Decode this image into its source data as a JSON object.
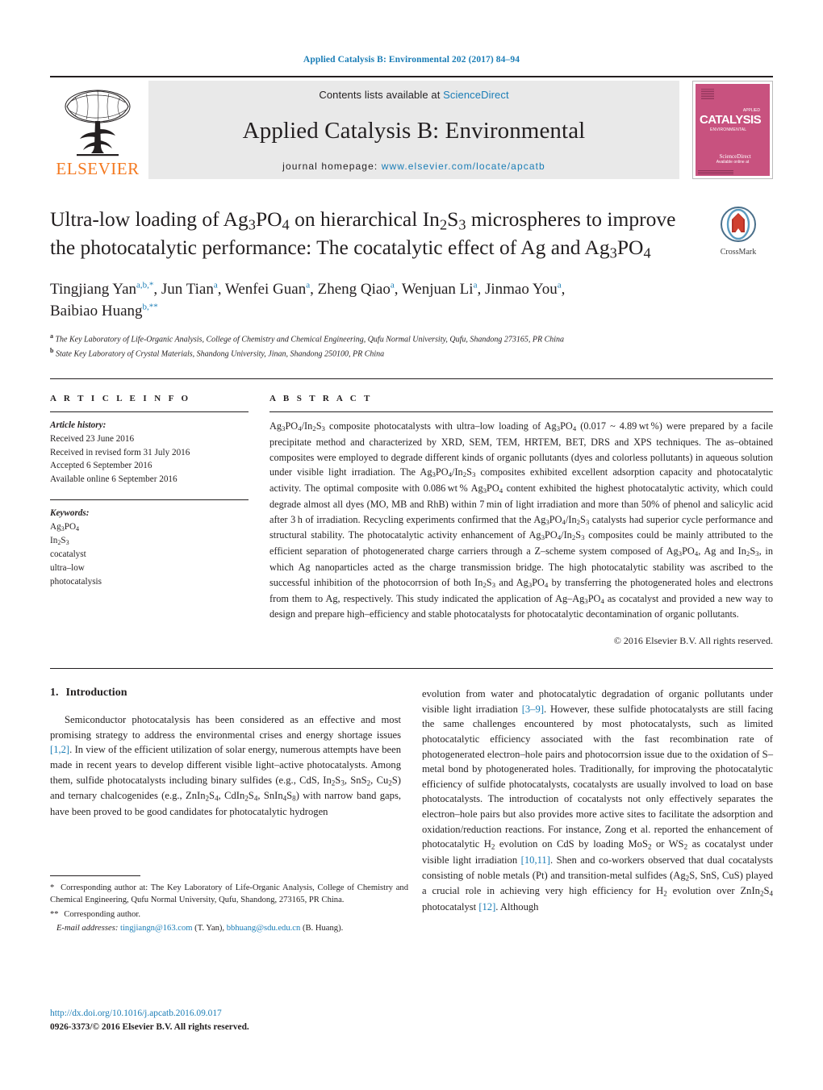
{
  "running_head": "Applied Catalysis B: Environmental 202 (2017) 84–94",
  "masthead": {
    "contents_prefix": "Contents lists available at ",
    "sciencedirect": "ScienceDirect",
    "journal_title": "Applied Catalysis B: Environmental",
    "homepage_prefix": "journal homepage: ",
    "homepage_url": "www.elsevier.com/locate/apcatb",
    "publisher": "ELSEVIER",
    "cover": {
      "title": "CATALYSIS",
      "superscript": "APPLIED",
      "subtitle": "ENVIRONMENTAL",
      "availability": "Available online at",
      "sciencedirect": "ScienceDirect"
    },
    "accent_blue": "#1a7db6",
    "elsevier_orange": "#f47920",
    "cover_pink": "#c8527f"
  },
  "article": {
    "title_line1": "Ultra-low loading of Ag3PO4 on hierarchical In2S3 microspheres to",
    "title_line2": "improve the photocatalytic performance: The cocatalytic effect of Ag",
    "title_line3": "and Ag3PO4",
    "crossmark_label": "CrossMark",
    "authors_line1": "Tingjiang Yan a,b,*, Jun Tian a, Wenfei Guan a, Zheng Qiao a, Wenjuan Li a, Jinmao You a,",
    "authors_line2": "Baibiao Huang b,**",
    "affiliation_a": "The Key Laboratory of Life-Organic Analysis, College of Chemistry and Chemical Engineering, Qufu Normal University, Qufu, Shandong 273165, PR China",
    "affiliation_b": "State Key Laboratory of Crystal Materials, Shandong University, Jinan, Shandong 250100, PR China"
  },
  "article_info": {
    "heading": "A R T I C L E    I N F O",
    "history_label": "Article history:",
    "received": "Received 23 June 2016",
    "revised": "Received in revised form 31 July 2016",
    "accepted": "Accepted 6 September 2016",
    "available": "Available online 6 September 2016",
    "keywords_label": "Keywords:",
    "keywords": [
      "Ag3PO4",
      "In2S3",
      "cocatalyst",
      "ultra–low",
      "photocatalysis"
    ]
  },
  "abstract": {
    "heading": "A B S T R A C T",
    "text": "Ag3PO4/In2S3 composite photocatalysts with ultra–low loading of Ag3PO4 (0.017 ~ 4.89 wt %) were prepared by a facile precipitate method and characterized by XRD, SEM, TEM, HRTEM, BET, DRS and XPS techniques. The as–obtained composites were employed to degrade different kinds of organic pollutants (dyes and colorless pollutants) in aqueous solution under visible light irradiation. The Ag3PO4/In2S3 composites exhibited excellent adsorption capacity and photocatalytic activity. The optimal composite with 0.086 wt % Ag3PO4 content exhibited the highest photocatalytic activity, which could degrade almost all dyes (MO, MB and RhB) within 7 min of light irradiation and more than 50% of phenol and salicylic acid after 3 h of irradiation. Recycling experiments confirmed that the Ag3PO4/In2S3 catalysts had superior cycle performance and structural stability. The photocatalytic activity enhancement of Ag3PO4/In2S3 composites could be mainly attributed to the efficient separation of photogenerated charge carriers through a Z–scheme system composed of Ag3PO4, Ag and In2S3, in which Ag nanoparticles acted as the charge transmission bridge. The high photocatalytic stability was ascribed to the successful inhibition of the photocorrsion of both In2S3 and Ag3PO4 by transferring the photogenerated holes and electrons from them to Ag, respectively. This study indicated the application of Ag–Ag3PO4 as cocatalyst and provided a new way to design and prepare high–efficiency and stable photocatalysts for photocatalytic decontamination of organic pollutants.",
    "copyright": "© 2016 Elsevier B.V. All rights reserved."
  },
  "introduction": {
    "number": "1.",
    "heading": "Introduction",
    "left_paragraph": "Semiconductor photocatalysis has been considered as an effective and most promising strategy to address the environmental crises and energy shortage issues [1,2]. In view of the efficient utilization of solar energy, numerous attempts have been made in recent years to develop different visible light–active photocatalysts. Among them, sulfide photocatalysts including binary sulfides (e.g., CdS, In2S3, SnS2, Cu2S) and ternary chalcogenides (e.g., ZnIn2S4, CdIn2S4, SnIn4S8) with narrow band gaps, have been proved to be good candidates for photocatalytic hydrogen",
    "right_paragraph": "evolution from water and photocatalytic degradation of organic pollutants under visible light irradiation [3–9]. However, these sulfide photocatalysts are still facing the same challenges encountered by most photocatalysts, such as limited photocatalytic efficiency associated with the fast recombination rate of photogenerated electron–hole pairs and photocorrsion issue due to the oxidation of S–metal bond by photogenerated holes. Traditionally, for improving the photocatalytic efficiency of sulfide photocatalysts, cocatalysts are usually involved to load on base photocatalysts. The introduction of cocatalysts not only effectively separates the electron–hole pairs but also provides more active sites to facilitate the adsorption and oxidation/reduction reactions. For instance, Zong et al. reported the enhancement of photocatalytic H2 evolution on CdS by loading MoS2 or WS2 as cocatalyst under visible light irradiation [10,11]. Shen and co-workers observed that dual cocatalysts consisting of noble metals (Pt) and transition-metal sulfides (Ag2S, SnS, CuS) played a crucial role in achieving very high efficiency for H2 evolution over ZnIn2S4 photocatalyst [12]. Although"
  },
  "footnotes": {
    "corresponding_1": "Corresponding author at: The Key Laboratory of Life-Organic Analysis, College of Chemistry and Chemical Engineering, Qufu Normal University, Qufu, Shandong, 273165, PR China.",
    "corresponding_2": "Corresponding author.",
    "email_label": "E-mail addresses:",
    "email_1": "tingjiangn@163.com",
    "email_1_owner": "(T. Yan),",
    "email_2": "bbhuang@sdu.edu.cn",
    "email_2_owner": "(B. Huang).",
    "star_1": "*",
    "star_2": "**"
  },
  "footer": {
    "doi": "http://dx.doi.org/10.1016/j.apcatb.2016.09.017",
    "issn_line": "0926-3373/© 2016 Elsevier B.V. All rights reserved."
  }
}
